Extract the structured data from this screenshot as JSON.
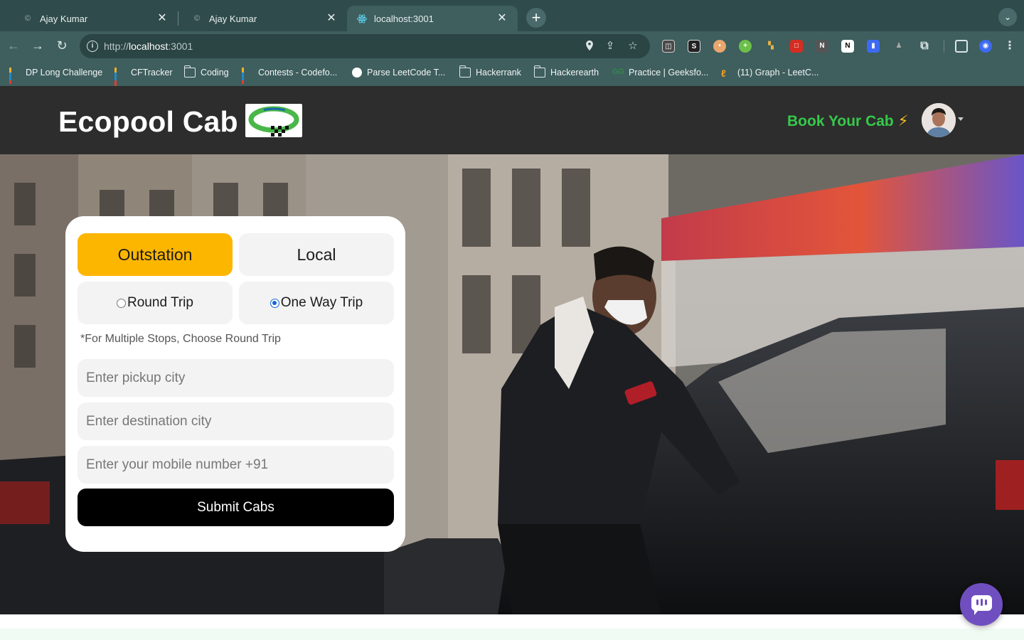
{
  "browser": {
    "tabs": [
      {
        "title": "Ajay Kumar",
        "favicon": "codeforces-icon"
      },
      {
        "title": "Ajay Kumar",
        "favicon": "codeforces-icon"
      },
      {
        "title": "localhost:3001",
        "favicon": "react-icon",
        "active": true
      }
    ],
    "address_bar": {
      "scheme": "http://",
      "host": "localhost",
      "port": ":3001"
    },
    "bookmarks": [
      {
        "label": "DP Long Challenge",
        "icon": "codechef-bars-icon"
      },
      {
        "label": "CFTracker",
        "icon": "codeforces-bars-icon"
      },
      {
        "label": "Coding",
        "icon": "folder-icon"
      },
      {
        "label": "Contests - Codefo...",
        "icon": "codeforces-bars-icon"
      },
      {
        "label": "Parse LeetCode T...",
        "icon": "globe-icon"
      },
      {
        "label": "Hackerrank",
        "icon": "folder-icon"
      },
      {
        "label": "Hackerearth",
        "icon": "folder-icon"
      },
      {
        "label": "Practice | Geeksfo...",
        "icon": "geeksforgeeks-icon"
      },
      {
        "label": "(11) Graph - LeetC...",
        "icon": "leetcode-icon"
      }
    ]
  },
  "header": {
    "brand": "Ecopool Cab",
    "cta": "Book Your Cab",
    "cta_icon": "⚡",
    "accent_color": "#36c94a"
  },
  "booking": {
    "trip_category_tabs": [
      {
        "label": "Outstation",
        "active": true
      },
      {
        "label": "Local",
        "active": false
      }
    ],
    "trip_types": [
      {
        "label": "Round Trip",
        "checked": false
      },
      {
        "label": "One Way Trip",
        "checked": true
      }
    ],
    "note": "*For Multiple Stops, Choose Round Trip",
    "pickup_placeholder": "Enter pickup city",
    "destination_placeholder": "Enter destination city",
    "mobile_placeholder": "Enter your mobile number +91",
    "submit_label": "Submit Cabs",
    "active_color": "#fdb600"
  }
}
